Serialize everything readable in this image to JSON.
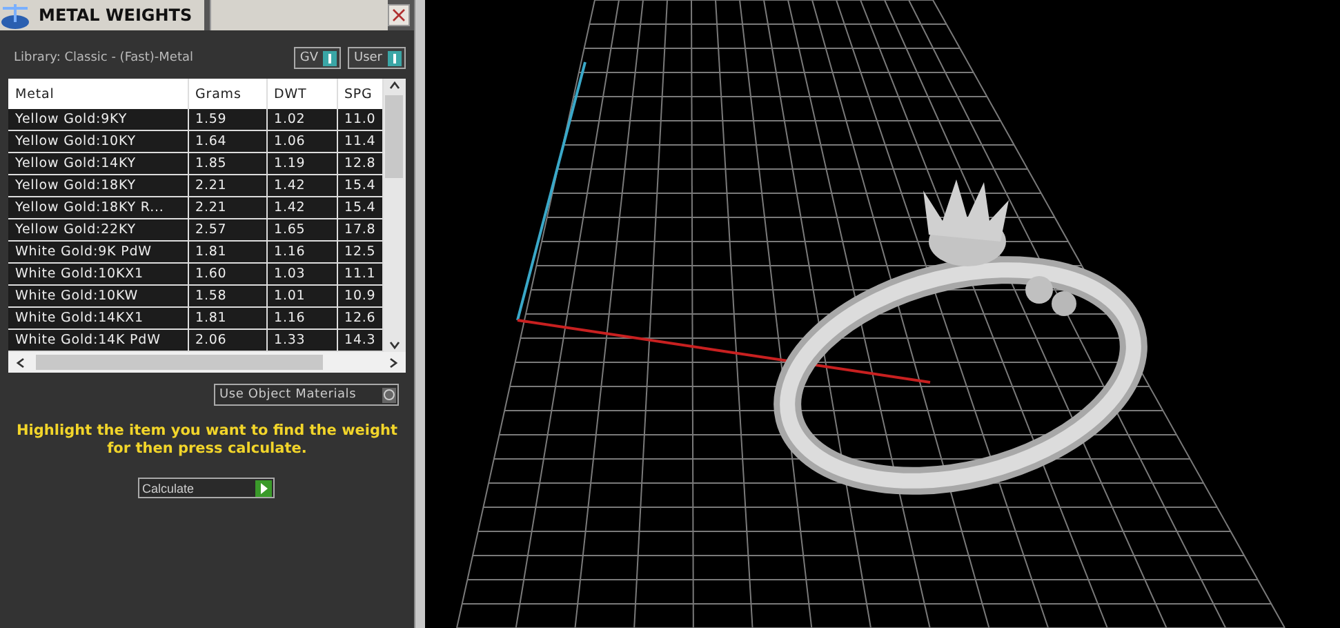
{
  "window": {
    "title": "METAL WEIGHTS"
  },
  "library_label": "Library: Classic - (Fast)-Metal",
  "toggles": [
    {
      "label": "GV",
      "on": true
    },
    {
      "label": "User",
      "on": true
    }
  ],
  "table": {
    "columns": [
      "Metal",
      "Grams",
      "DWT",
      "SPG"
    ],
    "rows": [
      [
        "Yellow Gold:9KY",
        "1.59",
        "1.02",
        "11.0"
      ],
      [
        "Yellow Gold:10KY",
        "1.64",
        "1.06",
        "11.4"
      ],
      [
        "Yellow Gold:14KY",
        "1.85",
        "1.19",
        "12.8"
      ],
      [
        "Yellow Gold:18KY",
        "2.21",
        "1.42",
        "15.4"
      ],
      [
        "Yellow Gold:18KY R...",
        "2.21",
        "1.42",
        "15.4"
      ],
      [
        "Yellow Gold:22KY",
        "2.57",
        "1.65",
        "17.8"
      ],
      [
        "White Gold:9K PdW",
        "1.81",
        "1.16",
        "12.5"
      ],
      [
        "White Gold:10KX1",
        "1.60",
        "1.03",
        "11.1"
      ],
      [
        "White Gold:10KW",
        "1.58",
        "1.01",
        "10.9"
      ],
      [
        "White Gold:14KX1",
        "1.81",
        "1.16",
        "12.6"
      ],
      [
        "White Gold:14K PdW",
        "2.06",
        "1.33",
        "14.3"
      ]
    ]
  },
  "object_materials": {
    "label": "Use Object Materials",
    "on": false
  },
  "hint": "Highlight the item you want to find the weight for then press calculate.",
  "calculate_button": "Calculate"
}
